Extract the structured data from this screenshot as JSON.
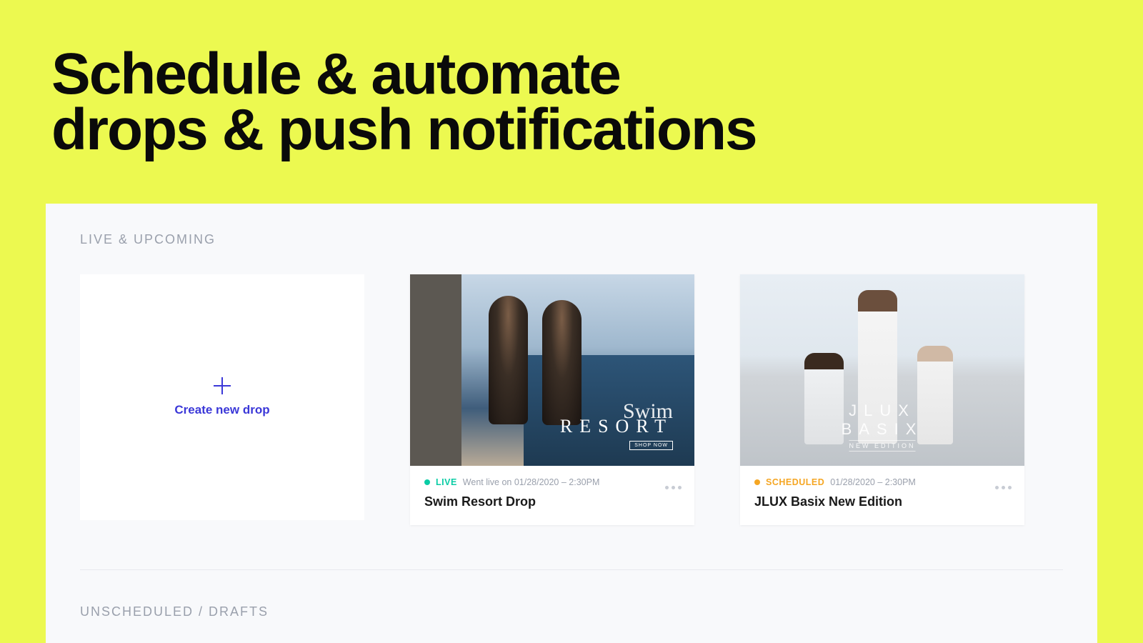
{
  "headline_line1": "Schedule & automate",
  "headline_line2": "drops & push notifications",
  "sections": {
    "live_upcoming": "LIVE & UPCOMING",
    "drafts": "UNSCHEDULED / DRAFTS"
  },
  "create_card": {
    "label": "Create new drop"
  },
  "drops": [
    {
      "status": "LIVE",
      "status_type": "live",
      "date_text": "Went live on 01/28/2020 – 2:30PM",
      "title": "Swim Resort Drop",
      "image_overlay": {
        "script": "Swim",
        "main": "RESORT",
        "cta": "SHOP NOW"
      }
    },
    {
      "status": "SCHEDULED",
      "status_type": "scheduled",
      "date_text": "01/28/2020 – 2:30PM",
      "title": "JLUX Basix New Edition",
      "image_overlay": {
        "main": "JLUX BASIX",
        "sub": "NEW EDITION"
      }
    }
  ]
}
